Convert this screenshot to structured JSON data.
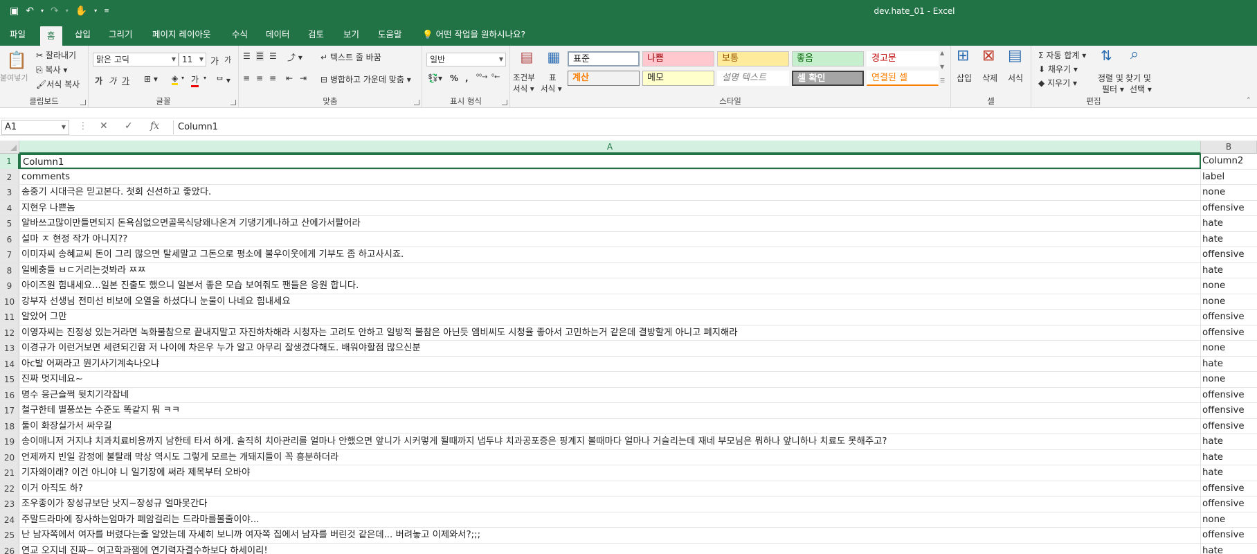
{
  "window": {
    "title": "dev.hate_01  -  Excel"
  },
  "qat": {
    "save": "save-icon",
    "undo": "undo-icon",
    "redo": "redo-icon",
    "touch": "touch-mode-icon",
    "customize": "customize-icon"
  },
  "tabs": [
    "파일",
    "홈",
    "삽입",
    "그리기",
    "페이지 레이아웃",
    "수식",
    "데이터",
    "검토",
    "보기",
    "도움말",
    "어떤 작업을 원하시나요?"
  ],
  "ribbon": {
    "clipboard": {
      "paste": "붙여넣기",
      "cut": "잘라내기",
      "copy": "복사",
      "format_painter": "서식 복사",
      "label": "클립보드"
    },
    "font": {
      "name": "맑은 고딕",
      "size": "11",
      "grow": "가",
      "shrink": "가",
      "bold": "가",
      "italic": "가",
      "underline": "가",
      "label": "글꼴"
    },
    "align": {
      "wrap": "텍스트 줄 바꿈",
      "merge": "병합하고 가운데 맞춤",
      "label": "맞춤"
    },
    "number": {
      "format": "일반",
      "percent": "%",
      "comma": ",",
      "label": "표시 형식"
    },
    "styles": {
      "cond1": "조건부",
      "cond2": "서식",
      "table1": "표",
      "table2": "서식",
      "cells": [
        "표준",
        "나쁨",
        "보통",
        "좋음",
        "경고문",
        "계산",
        "메모",
        "설명 텍스트",
        "셀 확인",
        "연결된 셀"
      ],
      "label": "스타일"
    },
    "cells": {
      "insert": "삽입",
      "delete": "삭제",
      "format": "서식",
      "label": "셀"
    },
    "edit": {
      "autosum": "자동 합계",
      "fill": "채우기",
      "clear": "지우기",
      "sort1": "정렬 및",
      "sort2": "필터",
      "find1": "찾기 및",
      "find2": "선택",
      "label": "편집"
    }
  },
  "formula_bar": {
    "name_box": "A1",
    "fx": "fx",
    "value": "Column1"
  },
  "grid": {
    "columns": [
      "A",
      "B"
    ],
    "rows": [
      {
        "n": "1",
        "a": "Column1",
        "b": "Column2"
      },
      {
        "n": "2",
        "a": "comments",
        "b": "label"
      },
      {
        "n": "3",
        "a": "송중기 시대극은 믿고본다. 첫회 신선하고 좋았다.",
        "b": "none"
      },
      {
        "n": "4",
        "a": "지현우 나쁜놈",
        "b": "offensive"
      },
      {
        "n": "5",
        "a": "알바쓰고많이만들면되지 돈욕심없으면골목식당왜나온겨 기댕기게나하고 산에가서팔어라",
        "b": "hate"
      },
      {
        "n": "6",
        "a": "설마 ㅈ 현정 작가 아니지??",
        "b": "hate"
      },
      {
        "n": "7",
        "a": "이미자씨 송혜교씨 돈이 그리 많으면 탈세말고 그돈으로 평소에 불우이웃에게 기부도 좀 하고사시죠.",
        "b": "offensive"
      },
      {
        "n": "8",
        "a": "일베충들 ㅂㄷ거리는것봐라 ㅉㅉ",
        "b": "hate"
      },
      {
        "n": "9",
        "a": "아이즈원 힘내세요...일본 진출도 했으니 일본서 좋은 모습 보여줘도 팬들은 응원 합니다.",
        "b": "none"
      },
      {
        "n": "10",
        "a": "강부자 선생님 전미선 비보에 오열을 하셨다니 눈물이 나네요 힘내세요",
        "b": "none"
      },
      {
        "n": "11",
        "a": "알았어 그만",
        "b": "offensive"
      },
      {
        "n": "12",
        "a": "이영자씨는 진정성 있는거라면 녹화불참으로 끝내지말고 자진하차해라 시청자는 고려도 안하고 일방적 불참은 아닌듯 엠비씨도 시청율 좋아서 고민하는거 같은데 결방할게 아니고 폐지해라",
        "b": "offensive"
      },
      {
        "n": "13",
        "a": "이경규가 이런거보면 세련되긴함 저 나이에 차은우 누가 알고 아무리 잘생겼다해도. 배워야할점 많으신분",
        "b": "none"
      },
      {
        "n": "14",
        "a": "아c발 어쩌라고 뭔기사기계속나오냐",
        "b": "hate"
      },
      {
        "n": "15",
        "a": "진짜 멋지네요~",
        "b": "none"
      },
      {
        "n": "16",
        "a": "명수 응근슬쩍 뒷치기각잡네",
        "b": "offensive"
      },
      {
        "n": "17",
        "a": "철구한테 별풍쏘는 수준도 똑같지 뭐 ㅋㅋ",
        "b": "offensive"
      },
      {
        "n": "18",
        "a": "둘이 화장실가서 싸우길",
        "b": "offensive"
      },
      {
        "n": "19",
        "a": "송이매니저 거지냐 치과치료비용까지 남한테 타서 하게. 솔직히 치아관리를 얼마나 안했으면 앞니가 시커멓게 될때까지 냅두냐 치과공포증은 핑계지 볼때마다 얼마나 거슬리는데 재네 부모님은 뭐하나 앞니하나 치료도 못해주고?",
        "b": "hate"
      },
      {
        "n": "20",
        "a": "언제까지 빈일 감정에 불탈래 막상 역시도 그렇게 모르는 개돼지들이 꼭 흥분하더라",
        "b": "hate"
      },
      {
        "n": "21",
        "a": "기자왜이래? 이건 아니야 니 일기장에 써라 제목부터 오바야",
        "b": "hate"
      },
      {
        "n": "22",
        "a": "이거 아직도 하?",
        "b": "offensive"
      },
      {
        "n": "23",
        "a": "조우종이가 장성규보단 낫지~장성규 얼마못간다",
        "b": "offensive"
      },
      {
        "n": "24",
        "a": "주말드라마에 장사하는엄마가 폐암걸리는 드라마를볼줄이야...",
        "b": "none"
      },
      {
        "n": "25",
        "a": "난 남자쪽에서 여자를 버렸다는줄 알았는데 자세히 보니까 여자쪽 집에서 남자를 버린것 같은데... 버려놓고 이제와서?;;;",
        "b": "offensive"
      },
      {
        "n": "26",
        "a": "연교 오지네 진짜~ 여고학과잼에 연기력자결수하보다 하세이리!",
        "b": "hate"
      }
    ]
  }
}
